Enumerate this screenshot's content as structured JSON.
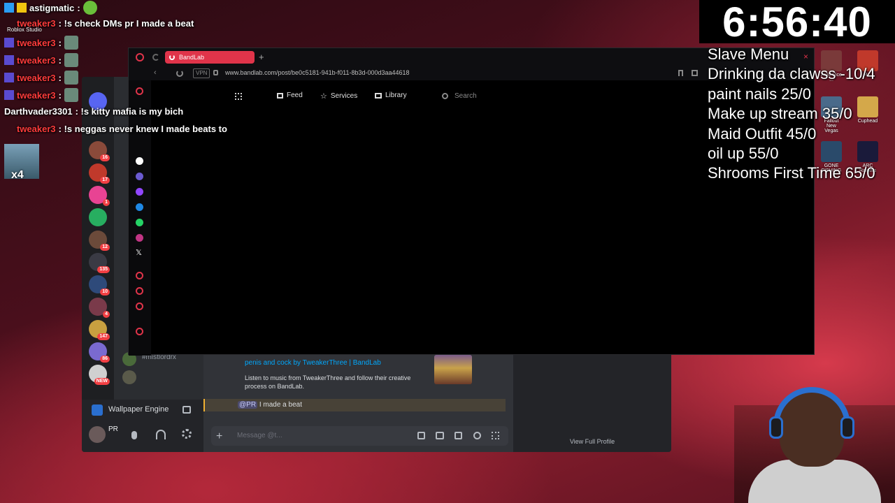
{
  "chat": {
    "messages": [
      {
        "user": "astigmatic",
        "text": " :",
        "color": "#ffffff"
      },
      {
        "user": "tweaker3",
        "text": ": !s check DMs pr I made a beat",
        "color": "#ff3b3b"
      },
      {
        "user": "tweaker3",
        "text": ":",
        "color": "#ff3b3b"
      },
      {
        "user": "tweaker3",
        "text": ":",
        "color": "#ff3b3b"
      },
      {
        "user": "tweaker3",
        "text": ":",
        "color": "#ff3b3b"
      },
      {
        "user": "tweaker3",
        "text": ":",
        "color": "#ff3b3b"
      },
      {
        "user": "Darthvader3301",
        "text": ": !s kitty mafia is my bich",
        "color": "#ffffff"
      },
      {
        "user": "tweaker3",
        "text": ": !s neggas never knew I made beats to",
        "color": "#ff3b3b"
      }
    ],
    "roblox_label": "Roblox Studio",
    "multiplier": "x4"
  },
  "timer": {
    "value": "6:56:40"
  },
  "menu": {
    "items": [
      "Slave Menu",
      "Drinking da clawss -10/4",
      "paint nails 25/0",
      "Make up stream 35/0",
      "Maid Outfit 45/0",
      "oil up 55/0",
      "Shrooms First Time 65/0"
    ]
  },
  "desktop_icons": [
    {
      "label": "Auto Vice ..."
    },
    {
      "label": "R..."
    },
    {
      "label": "Fallout New Vegas"
    },
    {
      "label": "Cuphead"
    },
    {
      "label": "GONE FISHING"
    },
    {
      "label": "ARC Raiders"
    }
  ],
  "browser": {
    "tab_title": "BandLab",
    "url": "www.bandlab.com/post/be0c5181-941b-f011-8b3d-000d3aa44618",
    "vpn_label": "VPN",
    "nav": {
      "feed": "Feed",
      "services": "Services",
      "library": "Library"
    },
    "search_placeholder": "Search"
  },
  "discord": {
    "channel_item": "#mistlordrx",
    "wallpaper_engine": "Wallpaper Engine",
    "username": "PR",
    "embed": {
      "title": "penis and cock by TweakerThree | BandLab",
      "description": "Listen to music from TweakerThree and follow their creative process on BandLab."
    },
    "mention_tag": "@PR",
    "mention_text": " I made a beat",
    "input_placeholder": "Message @t...",
    "view_full_profile": "View Full Profile",
    "server_badges": [
      "16",
      "17",
      "1",
      "12",
      "135",
      "10",
      "4",
      "147",
      "86",
      "NEW"
    ]
  },
  "colors": {
    "accent": "#e0344a",
    "discord_bg": "#313338",
    "link": "#00a8fc"
  }
}
